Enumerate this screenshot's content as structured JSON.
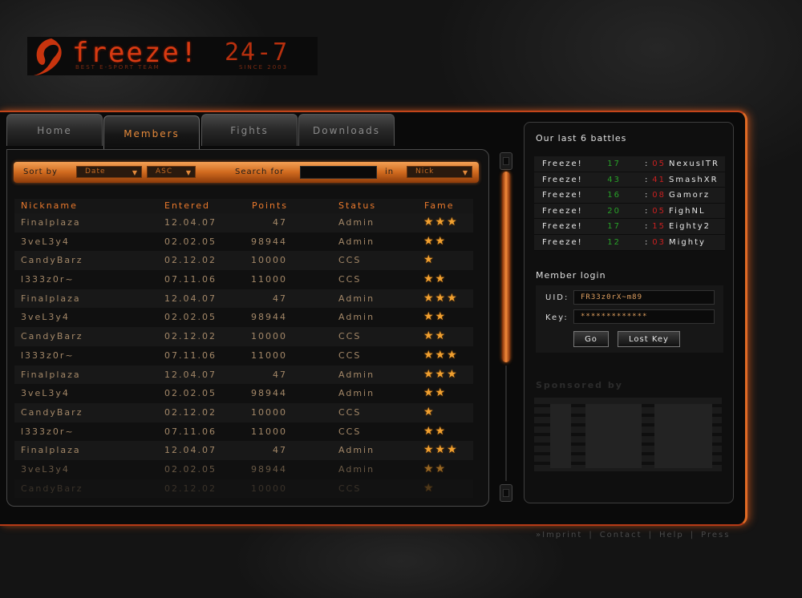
{
  "logo": {
    "name": "freeze!",
    "tagline": "BEST E-SPORT TEAM",
    "number": "24-7",
    "since": "SINCE 2003"
  },
  "tabs": [
    "Home",
    "Members",
    "Fights",
    "Downloads"
  ],
  "active_tab": "Members",
  "sortbar": {
    "sort_label": "Sort by",
    "sort_field": "Date",
    "sort_order": "ASC",
    "search_label": "Search for",
    "search_value": "",
    "in_label": "in",
    "search_field": "Nick"
  },
  "table": {
    "headers": [
      "Nickname",
      "Entered",
      "Points",
      "Status",
      "Fame"
    ],
    "rows": [
      {
        "nick": "Finalplaza",
        "date": "12.04.07",
        "points": "47",
        "status": "Admin",
        "fame": 3
      },
      {
        "nick": "3veL3y4",
        "date": "02.02.05",
        "points": "98944",
        "status": "Admin",
        "fame": 2
      },
      {
        "nick": "CandyBarz",
        "date": "02.12.02",
        "points": "10000",
        "status": "CCS",
        "fame": 1
      },
      {
        "nick": "l333z0r~",
        "date": "07.11.06",
        "points": "11000",
        "status": "CCS",
        "fame": 2
      },
      {
        "nick": "Finalplaza",
        "date": "12.04.07",
        "points": "47",
        "status": "Admin",
        "fame": 3
      },
      {
        "nick": "3veL3y4",
        "date": "02.02.05",
        "points": "98944",
        "status": "Admin",
        "fame": 2
      },
      {
        "nick": "CandyBarz",
        "date": "02.12.02",
        "points": "10000",
        "status": "CCS",
        "fame": 2
      },
      {
        "nick": "l333z0r~",
        "date": "07.11.06",
        "points": "11000",
        "status": "CCS",
        "fame": 3
      },
      {
        "nick": "Finalplaza",
        "date": "12.04.07",
        "points": "47",
        "status": "Admin",
        "fame": 3
      },
      {
        "nick": "3veL3y4",
        "date": "02.02.05",
        "points": "98944",
        "status": "Admin",
        "fame": 2
      },
      {
        "nick": "CandyBarz",
        "date": "02.12.02",
        "points": "10000",
        "status": "CCS",
        "fame": 1
      },
      {
        "nick": "l333z0r~",
        "date": "07.11.06",
        "points": "11000",
        "status": "CCS",
        "fame": 2
      },
      {
        "nick": "Finalplaza",
        "date": "12.04.07",
        "points": "47",
        "status": "Admin",
        "fame": 3
      },
      {
        "nick": "3veL3y4",
        "date": "02.02.05",
        "points": "98944",
        "status": "Admin",
        "fame": 2
      },
      {
        "nick": "CandyBarz",
        "date": "02.12.02",
        "points": "10000",
        "status": "CCS",
        "fame": 1
      }
    ]
  },
  "battles": {
    "title": "Our last 6 battles",
    "rows": [
      {
        "team": "Freeze!",
        "score1": "17",
        "score2": "05",
        "opponent": "NexusITR"
      },
      {
        "team": "Freeze!",
        "score1": "43",
        "score2": "41",
        "opponent": "SmashXR"
      },
      {
        "team": "Freeze!",
        "score1": "16",
        "score2": "08",
        "opponent": "Gamorz"
      },
      {
        "team": "Freeze!",
        "score1": "20",
        "score2": "05",
        "opponent": "FighNL"
      },
      {
        "team": "Freeze!",
        "score1": "17",
        "score2": "15",
        "opponent": "Eighty2"
      },
      {
        "team": "Freeze!",
        "score1": "12",
        "score2": "03",
        "opponent": "Mighty"
      }
    ],
    "win_color": "#28a028",
    "loss_color": "#c82020"
  },
  "login": {
    "title": "Member login",
    "uid_label": "UID:",
    "uid_value": "FR33z0rX~m89",
    "key_label": "Key:",
    "key_value": "*************",
    "go_label": "Go",
    "lost_label": "Lost Key"
  },
  "sponsor": {
    "label": "Sponsored by",
    "name": "IBM"
  },
  "footer": [
    "»Imprint",
    "Contact",
    "Help",
    "Press"
  ],
  "colors": {
    "accent": "#ec7a2c",
    "star": "#f0a030"
  }
}
